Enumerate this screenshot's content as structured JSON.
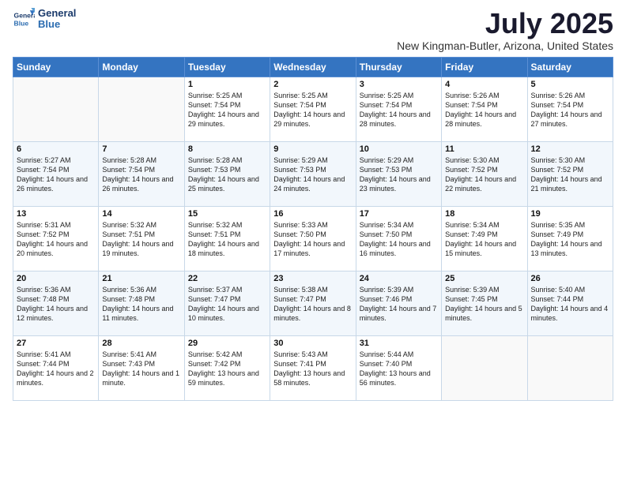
{
  "logo": {
    "line1": "General",
    "line2": "Blue"
  },
  "title": "July 2025",
  "location": "New Kingman-Butler, Arizona, United States",
  "weekdays": [
    "Sunday",
    "Monday",
    "Tuesday",
    "Wednesday",
    "Thursday",
    "Friday",
    "Saturday"
  ],
  "weeks": [
    [
      {
        "day": "",
        "sunrise": "",
        "sunset": "",
        "daylight": ""
      },
      {
        "day": "",
        "sunrise": "",
        "sunset": "",
        "daylight": ""
      },
      {
        "day": "1",
        "sunrise": "Sunrise: 5:25 AM",
        "sunset": "Sunset: 7:54 PM",
        "daylight": "Daylight: 14 hours and 29 minutes."
      },
      {
        "day": "2",
        "sunrise": "Sunrise: 5:25 AM",
        "sunset": "Sunset: 7:54 PM",
        "daylight": "Daylight: 14 hours and 29 minutes."
      },
      {
        "day": "3",
        "sunrise": "Sunrise: 5:25 AM",
        "sunset": "Sunset: 7:54 PM",
        "daylight": "Daylight: 14 hours and 28 minutes."
      },
      {
        "day": "4",
        "sunrise": "Sunrise: 5:26 AM",
        "sunset": "Sunset: 7:54 PM",
        "daylight": "Daylight: 14 hours and 28 minutes."
      },
      {
        "day": "5",
        "sunrise": "Sunrise: 5:26 AM",
        "sunset": "Sunset: 7:54 PM",
        "daylight": "Daylight: 14 hours and 27 minutes."
      }
    ],
    [
      {
        "day": "6",
        "sunrise": "Sunrise: 5:27 AM",
        "sunset": "Sunset: 7:54 PM",
        "daylight": "Daylight: 14 hours and 26 minutes."
      },
      {
        "day": "7",
        "sunrise": "Sunrise: 5:28 AM",
        "sunset": "Sunset: 7:54 PM",
        "daylight": "Daylight: 14 hours and 26 minutes."
      },
      {
        "day": "8",
        "sunrise": "Sunrise: 5:28 AM",
        "sunset": "Sunset: 7:53 PM",
        "daylight": "Daylight: 14 hours and 25 minutes."
      },
      {
        "day": "9",
        "sunrise": "Sunrise: 5:29 AM",
        "sunset": "Sunset: 7:53 PM",
        "daylight": "Daylight: 14 hours and 24 minutes."
      },
      {
        "day": "10",
        "sunrise": "Sunrise: 5:29 AM",
        "sunset": "Sunset: 7:53 PM",
        "daylight": "Daylight: 14 hours and 23 minutes."
      },
      {
        "day": "11",
        "sunrise": "Sunrise: 5:30 AM",
        "sunset": "Sunset: 7:52 PM",
        "daylight": "Daylight: 14 hours and 22 minutes."
      },
      {
        "day": "12",
        "sunrise": "Sunrise: 5:30 AM",
        "sunset": "Sunset: 7:52 PM",
        "daylight": "Daylight: 14 hours and 21 minutes."
      }
    ],
    [
      {
        "day": "13",
        "sunrise": "Sunrise: 5:31 AM",
        "sunset": "Sunset: 7:52 PM",
        "daylight": "Daylight: 14 hours and 20 minutes."
      },
      {
        "day": "14",
        "sunrise": "Sunrise: 5:32 AM",
        "sunset": "Sunset: 7:51 PM",
        "daylight": "Daylight: 14 hours and 19 minutes."
      },
      {
        "day": "15",
        "sunrise": "Sunrise: 5:32 AM",
        "sunset": "Sunset: 7:51 PM",
        "daylight": "Daylight: 14 hours and 18 minutes."
      },
      {
        "day": "16",
        "sunrise": "Sunrise: 5:33 AM",
        "sunset": "Sunset: 7:50 PM",
        "daylight": "Daylight: 14 hours and 17 minutes."
      },
      {
        "day": "17",
        "sunrise": "Sunrise: 5:34 AM",
        "sunset": "Sunset: 7:50 PM",
        "daylight": "Daylight: 14 hours and 16 minutes."
      },
      {
        "day": "18",
        "sunrise": "Sunrise: 5:34 AM",
        "sunset": "Sunset: 7:49 PM",
        "daylight": "Daylight: 14 hours and 15 minutes."
      },
      {
        "day": "19",
        "sunrise": "Sunrise: 5:35 AM",
        "sunset": "Sunset: 7:49 PM",
        "daylight": "Daylight: 14 hours and 13 minutes."
      }
    ],
    [
      {
        "day": "20",
        "sunrise": "Sunrise: 5:36 AM",
        "sunset": "Sunset: 7:48 PM",
        "daylight": "Daylight: 14 hours and 12 minutes."
      },
      {
        "day": "21",
        "sunrise": "Sunrise: 5:36 AM",
        "sunset": "Sunset: 7:48 PM",
        "daylight": "Daylight: 14 hours and 11 minutes."
      },
      {
        "day": "22",
        "sunrise": "Sunrise: 5:37 AM",
        "sunset": "Sunset: 7:47 PM",
        "daylight": "Daylight: 14 hours and 10 minutes."
      },
      {
        "day": "23",
        "sunrise": "Sunrise: 5:38 AM",
        "sunset": "Sunset: 7:47 PM",
        "daylight": "Daylight: 14 hours and 8 minutes."
      },
      {
        "day": "24",
        "sunrise": "Sunrise: 5:39 AM",
        "sunset": "Sunset: 7:46 PM",
        "daylight": "Daylight: 14 hours and 7 minutes."
      },
      {
        "day": "25",
        "sunrise": "Sunrise: 5:39 AM",
        "sunset": "Sunset: 7:45 PM",
        "daylight": "Daylight: 14 hours and 5 minutes."
      },
      {
        "day": "26",
        "sunrise": "Sunrise: 5:40 AM",
        "sunset": "Sunset: 7:44 PM",
        "daylight": "Daylight: 14 hours and 4 minutes."
      }
    ],
    [
      {
        "day": "27",
        "sunrise": "Sunrise: 5:41 AM",
        "sunset": "Sunset: 7:44 PM",
        "daylight": "Daylight: 14 hours and 2 minutes."
      },
      {
        "day": "28",
        "sunrise": "Sunrise: 5:41 AM",
        "sunset": "Sunset: 7:43 PM",
        "daylight": "Daylight: 14 hours and 1 minute."
      },
      {
        "day": "29",
        "sunrise": "Sunrise: 5:42 AM",
        "sunset": "Sunset: 7:42 PM",
        "daylight": "Daylight: 13 hours and 59 minutes."
      },
      {
        "day": "30",
        "sunrise": "Sunrise: 5:43 AM",
        "sunset": "Sunset: 7:41 PM",
        "daylight": "Daylight: 13 hours and 58 minutes."
      },
      {
        "day": "31",
        "sunrise": "Sunrise: 5:44 AM",
        "sunset": "Sunset: 7:40 PM",
        "daylight": "Daylight: 13 hours and 56 minutes."
      },
      {
        "day": "",
        "sunrise": "",
        "sunset": "",
        "daylight": ""
      },
      {
        "day": "",
        "sunrise": "",
        "sunset": "",
        "daylight": ""
      }
    ]
  ]
}
